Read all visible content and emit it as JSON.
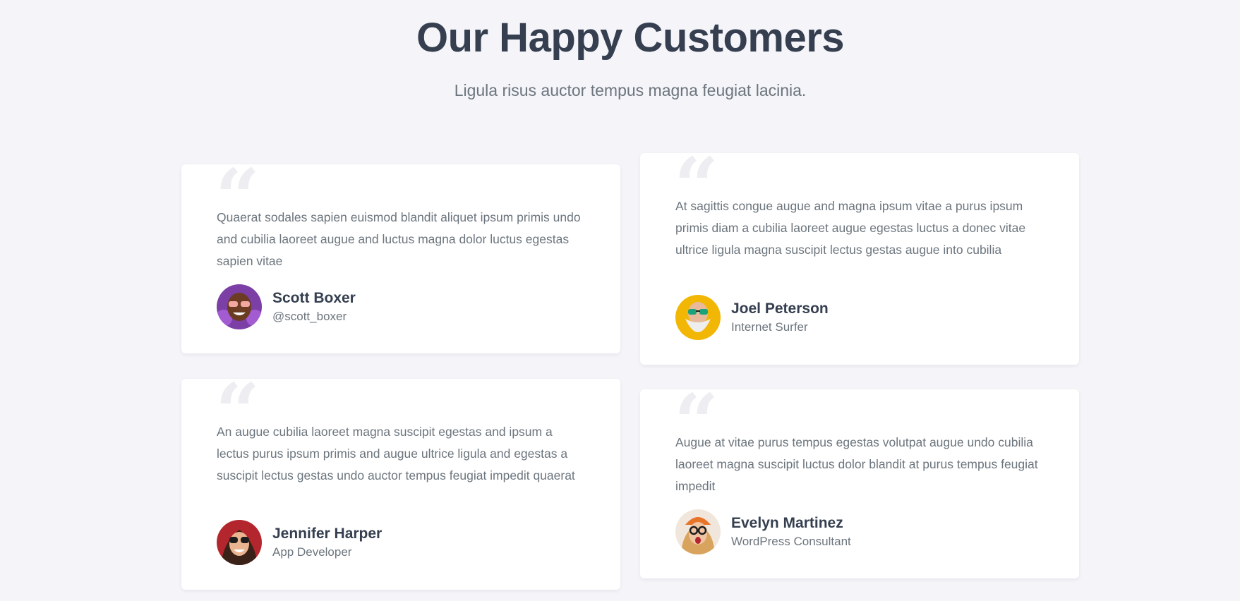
{
  "section": {
    "title": "Our Happy Customers",
    "subtitle": "Ligula risus auctor tempus magna feugiat lacinia."
  },
  "testimonials": [
    {
      "text": "Quaerat sodales sapien euismod blandit aliquet ipsum primis undo and cubilia laoreet augue and luctus magna dolor luctus egestas sapien vitae",
      "name": "Scott Boxer",
      "role": "@scott_boxer",
      "avatar_color": "#7b3fa6"
    },
    {
      "text": "At sagittis congue augue and magna ipsum vitae a purus ipsum primis diam a cubilia laoreet augue egestas luctus a donec vitae ultrice ligula magna suscipit lectus gestas augue into cubilia",
      "name": "Joel Peterson",
      "role": "Internet Surfer",
      "avatar_color": "#f2b705"
    },
    {
      "text": "An augue cubilia laoreet magna suscipit egestas and ipsum a lectus purus ipsum primis and augue ultrice ligula and egestas a suscipit lectus gestas undo auctor tempus feugiat impedit quaerat",
      "name": "Jennifer Harper",
      "role": "App Developer",
      "avatar_color": "#b3262d"
    },
    {
      "text": "Augue at vitae purus tempus egestas volutpat augue undo cubilia laoreet magna suscipit luctus dolor blandit at purus tempus feugiat impedit",
      "name": "Evelyn Martinez",
      "role": "WordPress Consultant",
      "avatar_color": "#e8742a"
    }
  ],
  "icons": {
    "quote": "quote-icon",
    "avatar": "avatar"
  },
  "colors": {
    "background": "#f4f4f9",
    "card": "#ffffff",
    "heading": "#353f4f",
    "body_text": "#6c757d",
    "quote_mark": "#eeeef2"
  }
}
